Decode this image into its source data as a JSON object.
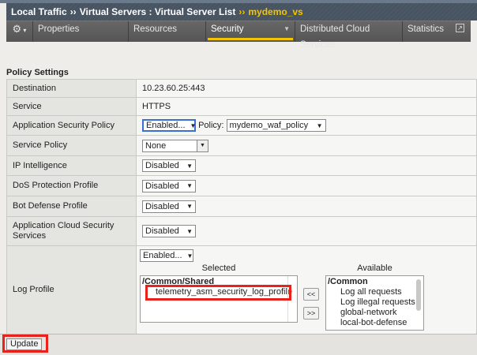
{
  "breadcrumb": {
    "items": [
      "Local Traffic",
      "Virtual Servers : Virtual Server List"
    ],
    "current": "mydemo_vs",
    "sep": "››"
  },
  "tabs": [
    {
      "label": "Properties"
    },
    {
      "label": "Resources"
    },
    {
      "label": "Security",
      "active": true
    },
    {
      "label": "Distributed Cloud Services"
    },
    {
      "label": "Statistics"
    }
  ],
  "section_title": "Policy Settings",
  "rows": {
    "destination": {
      "label": "Destination",
      "value": "10.23.60.25:443"
    },
    "service": {
      "label": "Service",
      "value": "HTTPS"
    },
    "asp": {
      "label": "Application Security Policy",
      "value": "Enabled...",
      "policy_label": "Policy:",
      "policy": "mydemo_waf_policy"
    },
    "service_policy": {
      "label": "Service Policy",
      "value": "None"
    },
    "ip": {
      "label": "IP Intelligence",
      "value": "Disabled"
    },
    "dos": {
      "label": "DoS Protection Profile",
      "value": "Disabled"
    },
    "bot": {
      "label": "Bot Defense Profile",
      "value": "Disabled"
    },
    "acss": {
      "label": "Application Cloud Security Services",
      "value": "Disabled"
    },
    "log": {
      "label": "Log Profile",
      "value": "Enabled...",
      "selected_label": "Selected",
      "available_label": "Available",
      "selected_group": "/Common/Shared",
      "selected_items": [
        "telemetry_asm_security_log_profile"
      ],
      "available_group": "/Common",
      "available_items": [
        "Log all requests",
        "Log illegal requests",
        "global-network",
        "local-bot-defense"
      ],
      "add_btn": "<<",
      "remove_btn": ">>"
    }
  },
  "update_label": "Update",
  "colors": {
    "accent": "#f5c400",
    "highlight": "#e8221b"
  }
}
